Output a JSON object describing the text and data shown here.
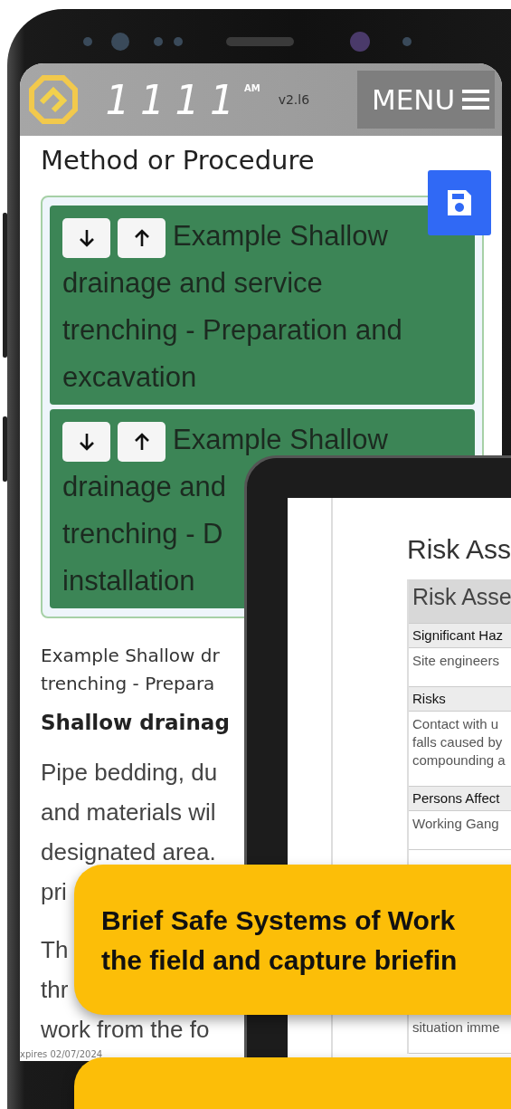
{
  "app_header": {
    "logo_digits": "1111",
    "logo_suffix": "AM",
    "version": "v2.l6",
    "menu_button": "MENU"
  },
  "page": {
    "title": "Method or Procedure",
    "steps": [
      {
        "title_lines": [
          "Example Shallow",
          "drainage and service",
          "trenching - Preparation and",
          "excavation"
        ]
      },
      {
        "title_lines": [
          "Example Shallow",
          "drainage and",
          "trenching - D",
          "installation"
        ]
      }
    ],
    "step_heading_lines": [
      "Example Shallow dr",
      "trenching - Prepara"
    ],
    "subheading": "Shallow drainag",
    "paragraphs": [
      [
        "Pipe bedding, du",
        "and materials wil",
        "designated area.",
        "pri"
      ],
      [
        "Th",
        "thr",
        "work from the fo"
      ]
    ],
    "footer": "xpires 02/07/2024"
  },
  "tablet": {
    "title": "Risk Ass",
    "rows": [
      {
        "kind": "header",
        "lines": [
          "Risk Asse"
        ]
      },
      {
        "kind": "label",
        "lines": [
          "Significant Haz"
        ]
      },
      {
        "kind": "value",
        "lines": [
          "Site engineers"
        ]
      },
      {
        "kind": "label",
        "lines": [
          "Risks"
        ]
      },
      {
        "kind": "value",
        "lines": [
          "Contact with u",
          "falls caused by",
          "compounding a"
        ]
      },
      {
        "kind": "label",
        "lines": [
          "Persons Affect"
        ]
      },
      {
        "kind": "value",
        "lines": [
          "Working Gang"
        ]
      },
      {
        "kind": "gap"
      },
      {
        "kind": "value",
        "lines": [
          "situation imme"
        ]
      }
    ]
  },
  "callouts": [
    {
      "lines": [
        "Brief Safe Systems of Work",
        "the field and capture briefin"
      ]
    }
  ]
}
